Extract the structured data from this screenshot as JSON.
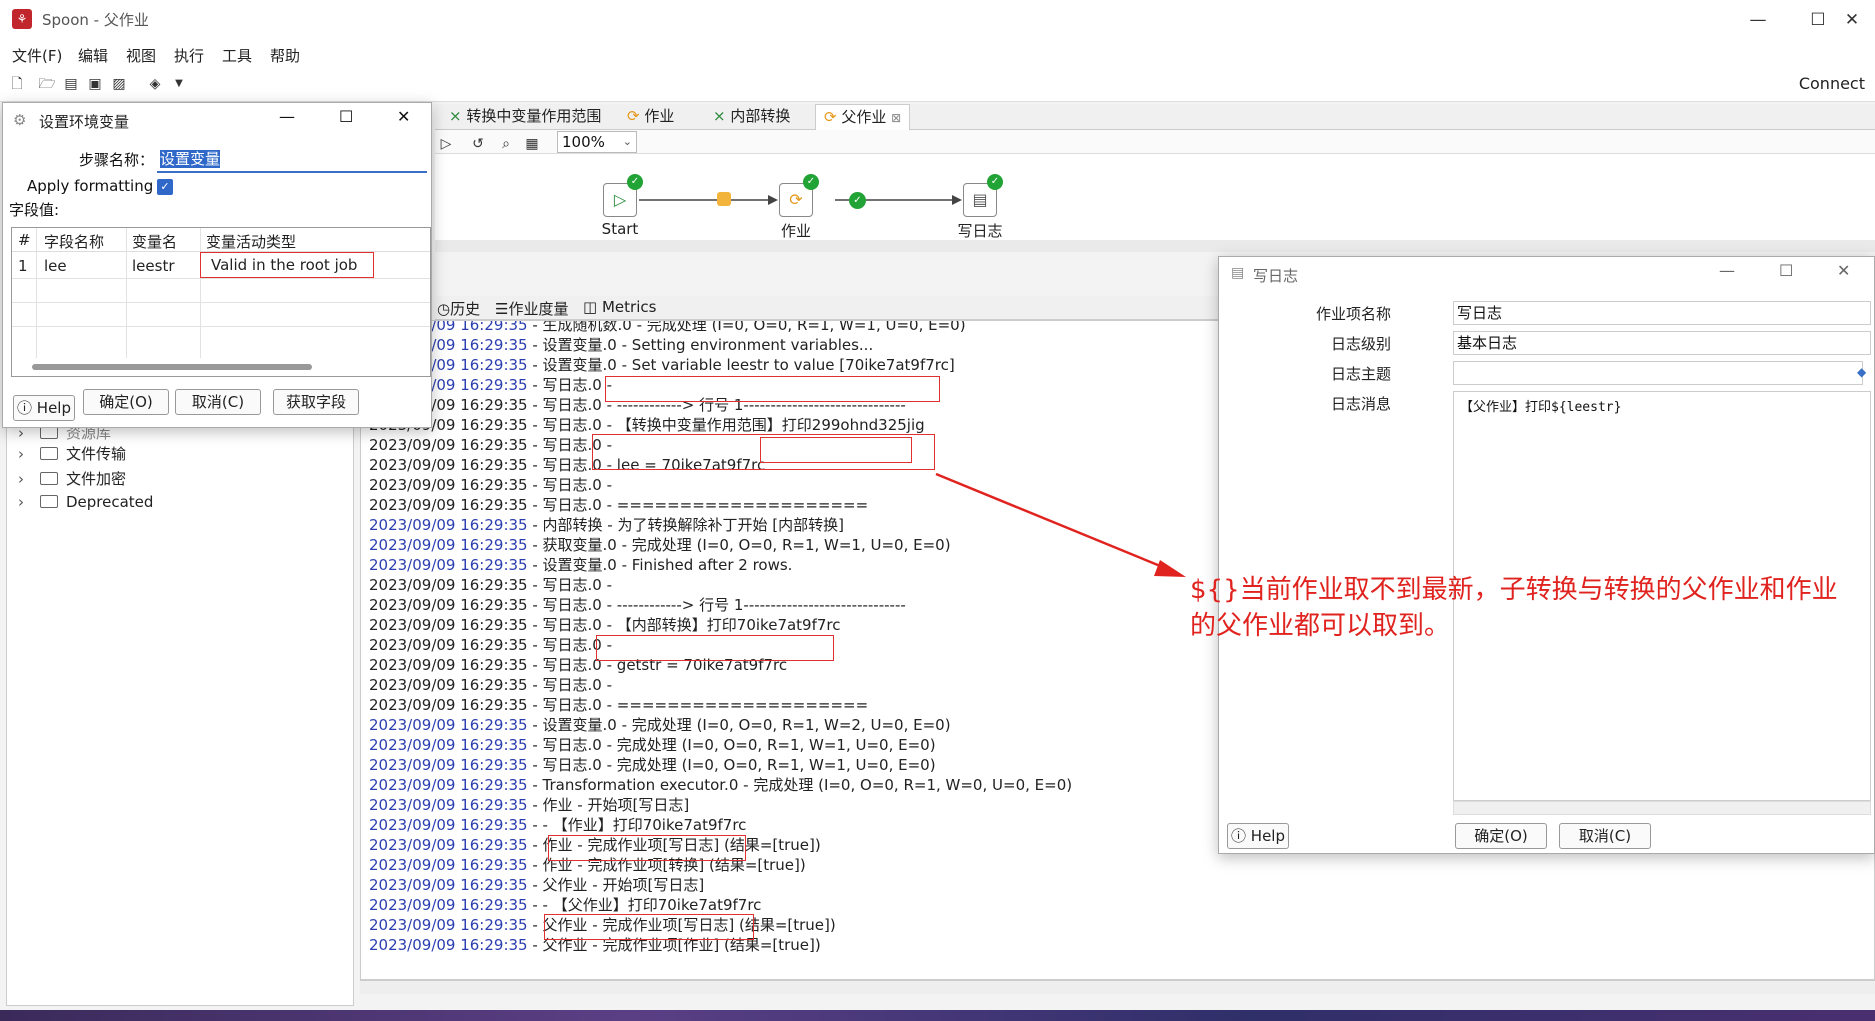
{
  "window": {
    "title": "Spoon - 父作业",
    "minimize": "—",
    "maximize": "☐",
    "close": "✕"
  },
  "menu": [
    "文件(F)",
    "编辑",
    "视图",
    "执行",
    "工具",
    "帮助"
  ],
  "toolbar": {
    "connect": "Connect"
  },
  "tree": [
    "文件传输",
    "文件加密",
    "Deprecated"
  ],
  "tree_partial": "资源库",
  "tabs": [
    {
      "label": "转换中变量作用范围",
      "icon": "transform-icon"
    },
    {
      "label": "作业",
      "icon": "job-icon"
    },
    {
      "label": "内部转换",
      "icon": "transform-icon"
    },
    {
      "label": "父作业",
      "icon": "job-icon",
      "close": "⊠"
    }
  ],
  "zoom": "100%",
  "workflow": {
    "nodes": [
      "Start",
      "作业",
      "写日志"
    ]
  },
  "sub_tabs": [
    "历史",
    "作业度量",
    "Metrics"
  ],
  "log_lines": [
    {
      "ts": "2023/09/09 16:29:35",
      "msg": " - 生成随机数.0 - 完成处理 (I=0, O=0, R=1, W=1, U=0, E=0)",
      "blue": true
    },
    {
      "ts": "2023/09/09 16:29:35",
      "msg": " - 设置变量.0 - Setting environment variables...",
      "blue": true
    },
    {
      "ts": "2023/09/09 16:29:35",
      "msg": " - 设置变量.0 - Set variable leestr to value [70ike7at9f7rc]",
      "blue": true
    },
    {
      "ts": "2023/09/09 16:29:35",
      "msg": " - 写日志.0 -",
      "blue": true
    },
    {
      "ts": "2023/09/09 16:29:35",
      "msg": " - 写日志.0 - ------------> 行号 1------------------------------",
      "blue": false
    },
    {
      "ts": "2023/09/09 16:29:35",
      "msg": " - 写日志.0 - 【转换中变量作用范围】打印299ohnd325jig",
      "blue": false
    },
    {
      "ts": "2023/09/09 16:29:35",
      "msg": " - 写日志.0 -",
      "blue": false
    },
    {
      "ts": "2023/09/09 16:29:35",
      "msg": " - 写日志.0 - lee = 70ike7at9f7rc",
      "blue": false
    },
    {
      "ts": "2023/09/09 16:29:35",
      "msg": " - 写日志.0 -",
      "blue": false
    },
    {
      "ts": "2023/09/09 16:29:35",
      "msg": " - 写日志.0 - ====================",
      "blue": false
    },
    {
      "ts": "2023/09/09 16:29:35",
      "msg": " - 内部转换 - 为了转换解除补丁开始  [内部转换]",
      "blue": true
    },
    {
      "ts": "2023/09/09 16:29:35",
      "msg": " - 获取变量.0 - 完成处理 (I=0, O=0, R=1, W=1, U=0, E=0)",
      "blue": true
    },
    {
      "ts": "2023/09/09 16:29:35",
      "msg": " - 设置变量.0 - Finished after 2 rows.",
      "blue": true
    },
    {
      "ts": "2023/09/09 16:29:35",
      "msg": " - 写日志.0 -",
      "blue": false
    },
    {
      "ts": "2023/09/09 16:29:35",
      "msg": " - 写日志.0 - ------------> 行号 1------------------------------",
      "blue": false
    },
    {
      "ts": "2023/09/09 16:29:35",
      "msg": " - 写日志.0 - 【内部转换】打印70ike7at9f7rc",
      "blue": false
    },
    {
      "ts": "2023/09/09 16:29:35",
      "msg": " - 写日志.0 -",
      "blue": false
    },
    {
      "ts": "2023/09/09 16:29:35",
      "msg": " - 写日志.0 - getstr = 70ike7at9f7rc",
      "blue": false
    },
    {
      "ts": "2023/09/09 16:29:35",
      "msg": " - 写日志.0 -",
      "blue": false
    },
    {
      "ts": "2023/09/09 16:29:35",
      "msg": " - 写日志.0 - ====================",
      "blue": false
    },
    {
      "ts": "2023/09/09 16:29:35",
      "msg": " - 设置变量.0 - 完成处理 (I=0, O=0, R=1, W=2, U=0, E=0)",
      "blue": true
    },
    {
      "ts": "2023/09/09 16:29:35",
      "msg": " - 写日志.0 - 完成处理 (I=0, O=0, R=1, W=1, U=0, E=0)",
      "blue": true
    },
    {
      "ts": "2023/09/09 16:29:35",
      "msg": " - 写日志.0 - 完成处理 (I=0, O=0, R=1, W=1, U=0, E=0)",
      "blue": true
    },
    {
      "ts": "2023/09/09 16:29:35",
      "msg": " - Transformation executor.0 - 完成处理 (I=0, O=0, R=1, W=0, U=0, E=0)",
      "blue": true
    },
    {
      "ts": "2023/09/09 16:29:35",
      "msg": " - 作业 - 开始项[写日志]",
      "blue": true
    },
    {
      "ts": "2023/09/09 16:29:35",
      "msg": " -  - 【作业】打印70ike7at9f7rc",
      "blue": true
    },
    {
      "ts": "2023/09/09 16:29:35",
      "msg": " - 作业 - 完成作业项[写日志] (结果=[true])",
      "blue": true
    },
    {
      "ts": "2023/09/09 16:29:35",
      "msg": " - 作业 - 完成作业项[转换] (结果=[true])",
      "blue": true
    },
    {
      "ts": "2023/09/09 16:29:35",
      "msg": " - 父作业 - 开始项[写日志]",
      "blue": true
    },
    {
      "ts": "2023/09/09 16:29:35",
      "msg": " -  - 【父作业】打印70ike7at9f7rc",
      "blue": true
    },
    {
      "ts": "2023/09/09 16:29:35",
      "msg": " - 父作业 - 完成作业项[写日志] (结果=[true])",
      "blue": true
    },
    {
      "ts": "2023/09/09 16:29:35",
      "msg": " - 父作业 - 完成作业项[作业] (结果=[true])",
      "blue": true
    }
  ],
  "env_dialog": {
    "title": "设置环境变量",
    "step_name_label": "步骤名称：",
    "step_name_value": "设置变量",
    "apply_formatting": "Apply formatting",
    "fields_label": "字段值:",
    "columns": [
      "#",
      "字段名称",
      "变量名",
      "变量活动类型"
    ],
    "rows": [
      {
        "num": "1",
        "field": "lee",
        "var": "leestr",
        "type": "Valid in the root job"
      }
    ],
    "help": "Help",
    "ok": "确定(O)",
    "cancel": "取消(C)",
    "get_fields": "获取字段"
  },
  "log_dialog": {
    "title": "写日志",
    "fields": [
      {
        "label": "作业项名称",
        "value": "写日志"
      },
      {
        "label": "日志级别",
        "value": "基本日志"
      },
      {
        "label": "日志主题",
        "value": ""
      },
      {
        "label": "日志消息",
        "value": "【父作业】打印${leestr}"
      }
    ],
    "help": "Help",
    "ok": "确定(O)",
    "cancel": "取消(C)"
  },
  "annotation": "${}当前作业取不到最新，子转换与转换的父作业和作业的父作业都可以取到。",
  "colors": {
    "timestamp": "#2b3eb0",
    "annotation": "#e0231f",
    "success": "#21a336"
  }
}
